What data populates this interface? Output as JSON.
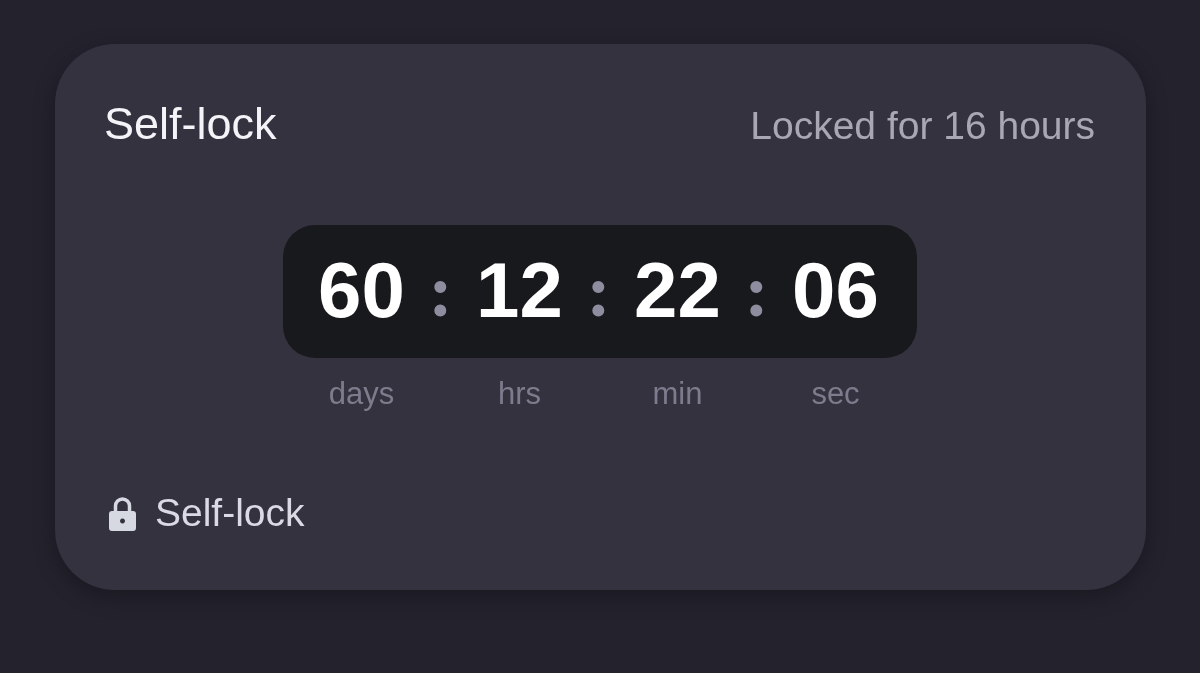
{
  "card": {
    "title": "Self-lock",
    "status": "Locked for 16 hours",
    "countdown": {
      "segments": [
        {
          "value": "60",
          "unit": "days"
        },
        {
          "value": "12",
          "unit": "hrs"
        },
        {
          "value": "22",
          "unit": "min"
        },
        {
          "value": "06",
          "unit": "sec"
        }
      ],
      "separators": [
        ":",
        ":",
        ":"
      ]
    },
    "footer": {
      "label": "Self-lock"
    }
  }
}
